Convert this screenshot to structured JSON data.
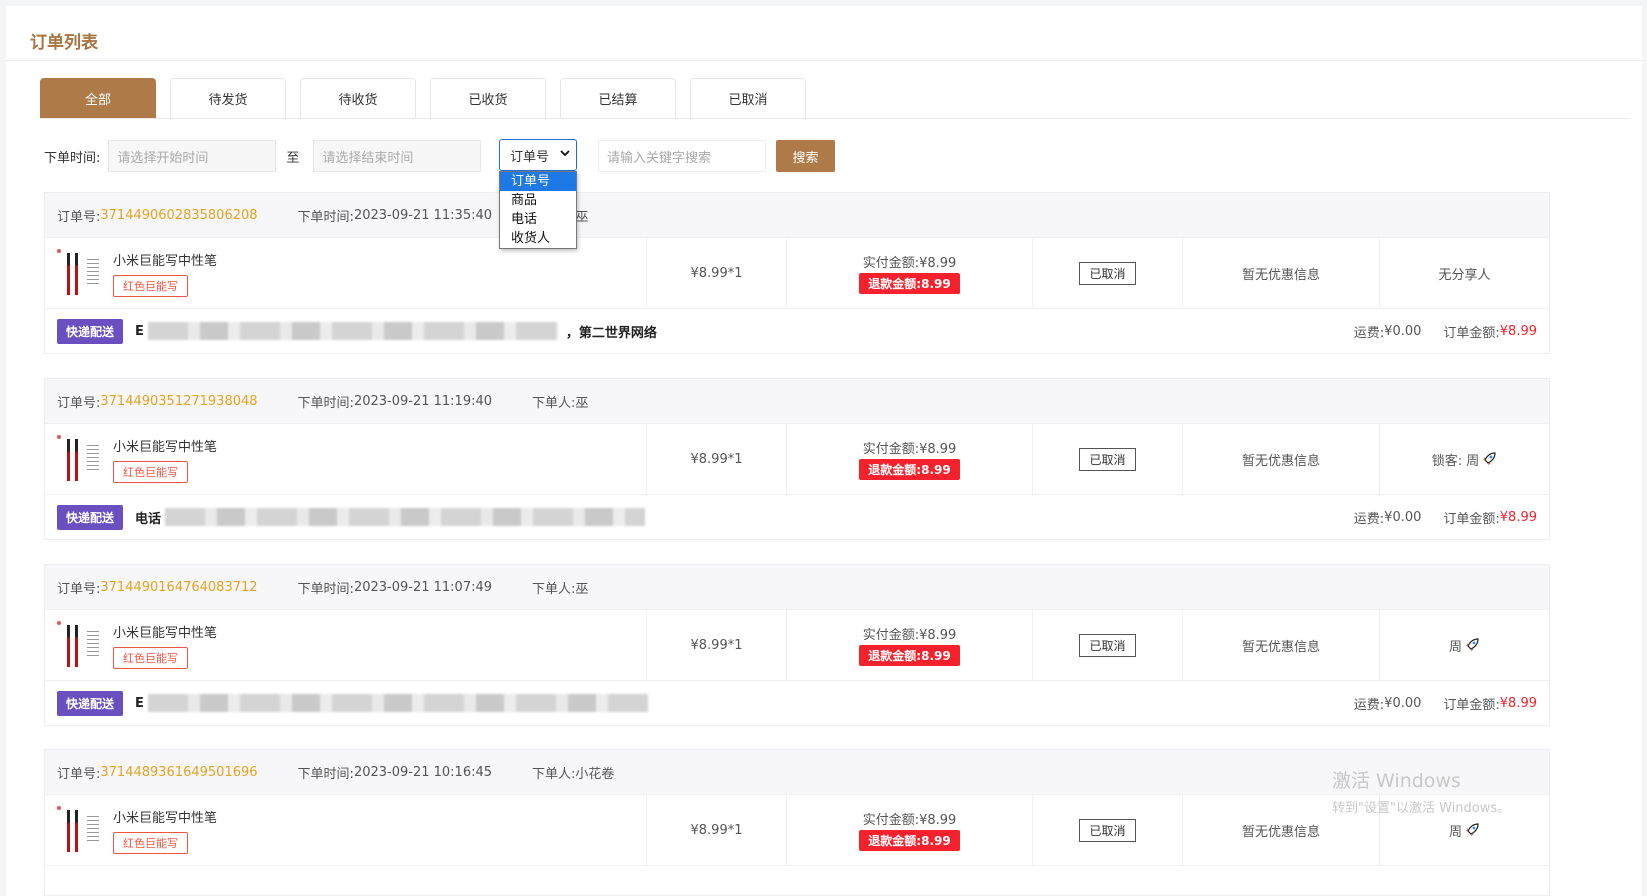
{
  "page": {
    "title": "订单列表"
  },
  "tabs": [
    "全部",
    "待发货",
    "待收货",
    "已收货",
    "已结算",
    "已取消"
  ],
  "filter": {
    "time_label": "下单时间:",
    "start_placeholder": "请选择开始时间",
    "to_label": "至",
    "end_placeholder": "请选择结束时间",
    "select_value": "订单号",
    "keyword_placeholder": "请输入关键字搜索",
    "search_label": "搜索",
    "options": [
      "订单号",
      "商品",
      "电话",
      "收货人"
    ]
  },
  "labels": {
    "order_no": "订单号:",
    "order_time": "下单时间:",
    "orderer": "下单人:",
    "paid": "实付金额:",
    "refund": "退款金额:",
    "ship_tag": "快递配送",
    "freight": "运费:",
    "total": "订单金额:"
  },
  "orders": [
    {
      "order_no": "3714490602835806208",
      "time": "2023-09-21 11:35:40",
      "orderer": "巫",
      "product": "小米巨能写中性笔",
      "spec": "红色巨能写",
      "price": "¥8.99*1",
      "paid": "¥8.99",
      "refund": "8.99",
      "status": "已取消",
      "promo": "暂无优惠信息",
      "share": "无分享人",
      "addr_prefix": "E",
      "addr_suffix": "，第二世界网络",
      "freight": "¥0.00",
      "total": "¥8.99"
    },
    {
      "order_no": "3714490351271938048",
      "time": "2023-09-21 11:19:40",
      "orderer": "巫",
      "product": "小米巨能写中性笔",
      "spec": "红色巨能写",
      "price": "¥8.99*1",
      "paid": "¥8.99",
      "refund": "8.99",
      "status": "已取消",
      "promo": "暂无优惠信息",
      "share": "锁客: 周",
      "addr_prefix": "电话",
      "addr_suffix": "",
      "freight": "¥0.00",
      "total": "¥8.99"
    },
    {
      "order_no": "3714490164764083712",
      "time": "2023-09-21 11:07:49",
      "orderer": "巫",
      "product": "小米巨能写中性笔",
      "spec": "红色巨能写",
      "price": "¥8.99*1",
      "paid": "¥8.99",
      "refund": "8.99",
      "status": "已取消",
      "promo": "暂无优惠信息",
      "share": "周",
      "addr_prefix": "E",
      "addr_suffix": "",
      "freight": "¥0.00",
      "total": "¥8.99"
    },
    {
      "order_no": "3714489361649501696",
      "time": "2023-09-21 10:16:45",
      "orderer": "小花卷",
      "product": "小米巨能写中性笔",
      "spec": "红色巨能写",
      "price": "¥8.99*1",
      "paid": "¥8.99",
      "refund": "8.99",
      "status": "已取消",
      "promo": "暂无优惠信息",
      "share": "周"
    }
  ],
  "watermark": {
    "line1": "激活 Windows",
    "line2": "转到\"设置\"以激活 Windows。"
  },
  "colors": {
    "accent": "#ad7a48",
    "order_no": "#e8a21f",
    "refund": "#f5222d",
    "ship_tag": "#6a4fc1"
  }
}
